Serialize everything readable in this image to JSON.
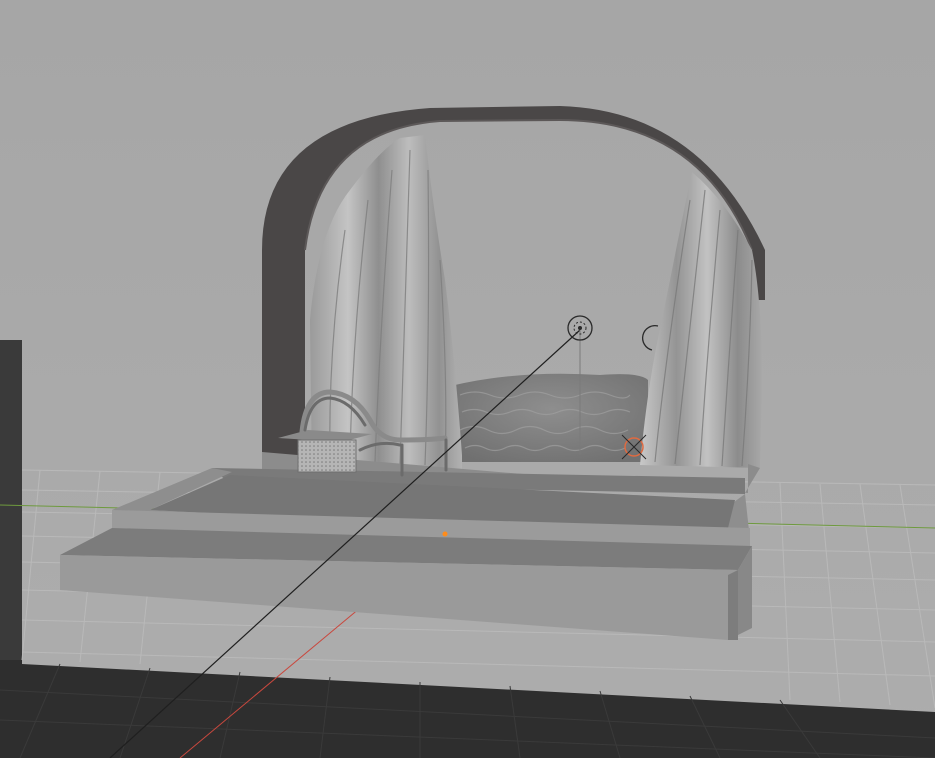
{
  "app": {
    "name": "3D Viewport"
  },
  "viewport": {
    "mode": "solid-shading",
    "background_color": "#a9a9a9",
    "floor_color": "#2e2e2e",
    "grid_color": "#b8b8b8",
    "axis_x_color": "#c9483e",
    "axis_y_color": "#6e9a3e",
    "origin_color": "#ff8c1a"
  },
  "scene": {
    "objects": [
      {
        "name": "arch-frame",
        "icon": "mesh-icon"
      },
      {
        "name": "curtain-left",
        "icon": "mesh-icon"
      },
      {
        "name": "curtain-right",
        "icon": "mesh-icon"
      },
      {
        "name": "lounge-chair",
        "icon": "mesh-icon"
      },
      {
        "name": "side-table",
        "icon": "mesh-icon"
      },
      {
        "name": "cloud-sea",
        "icon": "mesh-icon"
      },
      {
        "name": "stage-platform",
        "icon": "mesh-icon"
      },
      {
        "name": "stage-step",
        "icon": "mesh-icon"
      },
      {
        "name": "light-point",
        "icon": "light-icon"
      },
      {
        "name": "light-spot",
        "icon": "light-icon"
      },
      {
        "name": "camera-target",
        "icon": "empty-icon"
      }
    ]
  }
}
